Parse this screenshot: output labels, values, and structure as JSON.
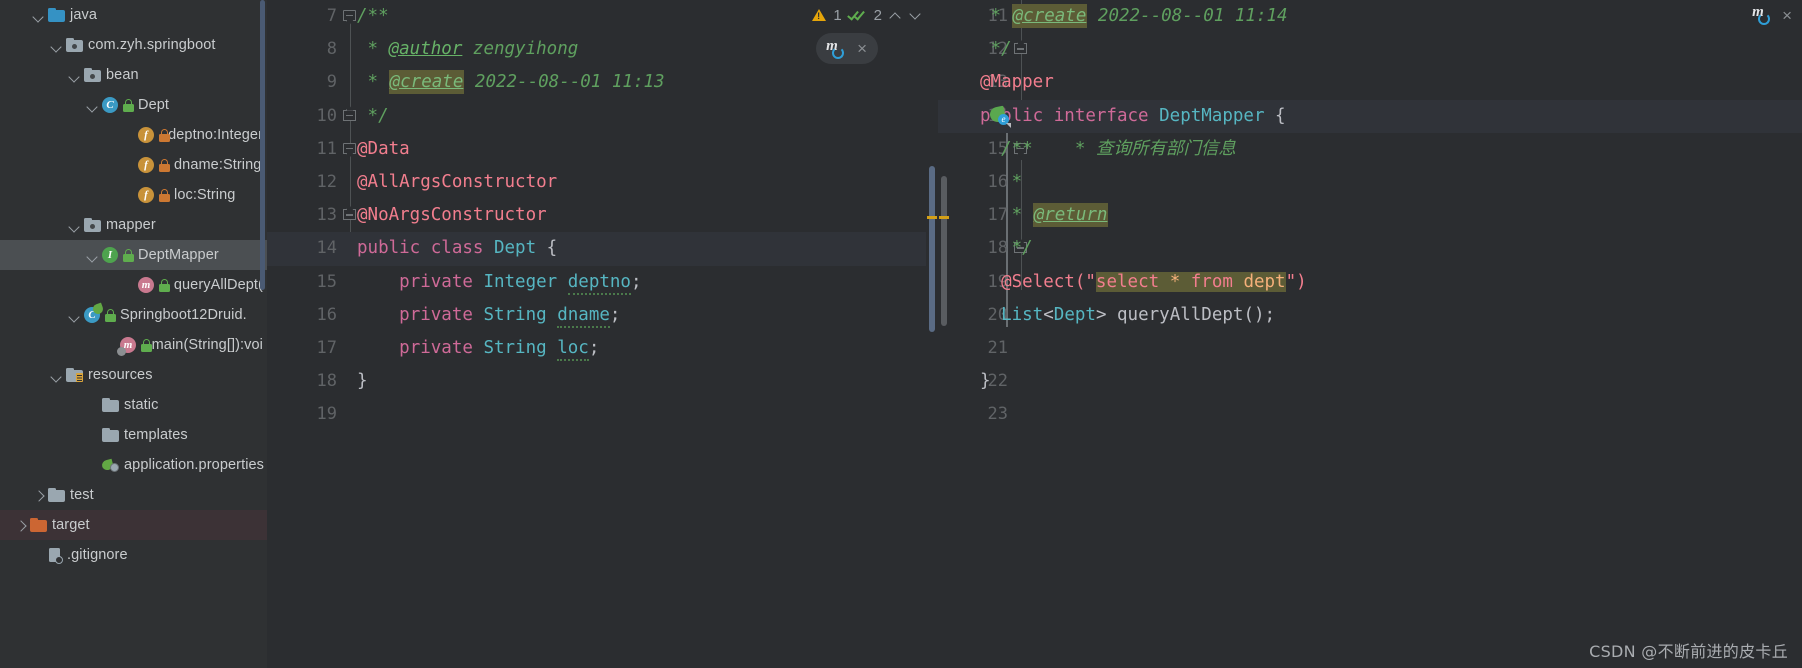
{
  "app": {
    "theme_bg": "#2b2d30",
    "accent": "#3592c4"
  },
  "sidebar": {
    "scroll_visible": true,
    "items": [
      {
        "label": "java",
        "indent": 1,
        "twisty": "down",
        "icon": "folder-blue-icon",
        "lock": "none",
        "selected": false
      },
      {
        "label": "com.zyh.springboot",
        "indent": 2,
        "twisty": "down",
        "icon": "package-icon",
        "lock": "none",
        "selected": false
      },
      {
        "label": "bean",
        "indent": 3,
        "twisty": "down",
        "icon": "package-icon",
        "lock": "none",
        "selected": false
      },
      {
        "label": "Dept",
        "indent": 4,
        "twisty": "down",
        "icon": "class-icon",
        "lock": "green",
        "selected": false
      },
      {
        "label": "deptno:Integer",
        "indent": 6,
        "twisty": "none",
        "icon": "field-icon",
        "lock": "orange",
        "selected": false
      },
      {
        "label": "dname:String",
        "indent": 6,
        "twisty": "none",
        "icon": "field-icon",
        "lock": "orange",
        "selected": false
      },
      {
        "label": "loc:String",
        "indent": 6,
        "twisty": "none",
        "icon": "field-icon",
        "lock": "orange",
        "selected": false
      },
      {
        "label": "mapper",
        "indent": 3,
        "twisty": "down",
        "icon": "package-icon",
        "lock": "none",
        "selected": false
      },
      {
        "label": "DeptMapper",
        "indent": 4,
        "twisty": "down",
        "icon": "interface-icon",
        "lock": "green",
        "selected": true
      },
      {
        "label": "queryAllDept(",
        "indent": 6,
        "twisty": "none",
        "icon": "method-icon",
        "lock": "green",
        "selected": false
      },
      {
        "label": "Springboot12Druid.",
        "indent": 3,
        "twisty": "down",
        "icon": "springboot-class-icon",
        "lock": "green",
        "selected": false
      },
      {
        "label": "main(String[]):voi",
        "indent": 5,
        "twisty": "none",
        "icon": "main-method-icon",
        "lock": "green",
        "selected": false
      },
      {
        "label": "resources",
        "indent": 2,
        "twisty": "down",
        "icon": "resources-folder-icon",
        "lock": "none",
        "selected": false
      },
      {
        "label": "static",
        "indent": 4,
        "twisty": "none",
        "icon": "folder-gray-icon",
        "lock": "none",
        "selected": false
      },
      {
        "label": "templates",
        "indent": 4,
        "twisty": "none",
        "icon": "folder-gray-icon",
        "lock": "none",
        "selected": false
      },
      {
        "label": "application.properties",
        "indent": 4,
        "twisty": "none",
        "icon": "spring-properties-icon",
        "lock": "none",
        "selected": false
      },
      {
        "label": "test",
        "indent": 1,
        "twisty": "right",
        "icon": "folder-gray-icon",
        "lock": "none",
        "selected": false
      },
      {
        "label": "target",
        "indent": 0,
        "twisty": "right",
        "icon": "folder-orange-icon",
        "lock": "none",
        "selected": false,
        "highlight": "target"
      },
      {
        "label": ".gitignore",
        "indent": 1,
        "twisty": "none",
        "icon": "gitignore-icon",
        "lock": "none",
        "selected": false
      }
    ]
  },
  "inspection_widget": {
    "warning_icon": "warning-triangle-icon",
    "warning_count": "1",
    "ok_icon": "double-check-icon",
    "ok_count": "2",
    "prev_icon": "chevron-up-icon",
    "next_icon": "chevron-down-icon"
  },
  "mybatis_badge_left": {
    "icon": "mybatis-sync-icon",
    "close": "×"
  },
  "mybatis_badge_right": {
    "icon": "mybatis-sync-icon",
    "close": "×"
  },
  "editor_left": {
    "file": "Dept.java",
    "first_line_number": 7,
    "current_line": 14,
    "lines": [
      {
        "n": 7,
        "fold": "open",
        "html": "<span class=\"cmt\">/**</span>"
      },
      {
        "n": 8,
        "fold": "none",
        "html": "<span class=\"cmt\"> * </span><span class=\"tag\">@author</span><span class=\"cmt\"> zengyihong</span>"
      },
      {
        "n": 9,
        "fold": "none",
        "html": "<span class=\"cmt\"> * </span><span class=\"tag-hl\">@create</span><span class=\"cmt\"> 2022--08--01 11:13</span>"
      },
      {
        "n": 10,
        "fold": "close",
        "html": "<span class=\"cmt\"> */</span>"
      },
      {
        "n": 11,
        "fold": "open",
        "html": "<span class=\"anno\">@Data</span>"
      },
      {
        "n": 12,
        "fold": "none",
        "html": "<span class=\"anno\">@AllArgsConstructor</span>"
      },
      {
        "n": 13,
        "fold": "close",
        "html": "<span class=\"anno\">@NoArgsConstructor</span>"
      },
      {
        "n": 14,
        "fold": "none",
        "html": "<span class=\"kw\">public class </span><span class=\"typ\">Dept</span><span class=\"pln\"> {</span>"
      },
      {
        "n": 15,
        "fold": "none",
        "html": "<span class=\"pln\">    </span><span class=\"kw\">private </span><span class=\"typ\">Integer </span><span class=\"ident squig\">deptno</span><span class=\"pln\">;</span>"
      },
      {
        "n": 16,
        "fold": "none",
        "html": "<span class=\"pln\">    </span><span class=\"kw\">private </span><span class=\"typ\">String </span><span class=\"ident squig\">dname</span><span class=\"pln\">;</span>"
      },
      {
        "n": 17,
        "fold": "none",
        "html": "<span class=\"pln\">    </span><span class=\"kw\">private </span><span class=\"typ\">String </span><span class=\"ident squig\">loc</span><span class=\"pln\">;</span>"
      },
      {
        "n": 18,
        "fold": "none",
        "html": "<span class=\"pln\">}</span>"
      },
      {
        "n": 19,
        "fold": "none",
        "html": ""
      }
    ],
    "plain_text": [
      "/**",
      " * @author zengyihong",
      " * @create 2022--08--01 11:13",
      " */",
      "@Data",
      "@AllArgsConstructor",
      "@NoArgsConstructor",
      "public class Dept {",
      "    private Integer deptno;",
      "    private String dname;",
      "    private String loc;",
      "}",
      ""
    ]
  },
  "editor_right": {
    "file": "DeptMapper.java",
    "first_line_number": 11,
    "current_line": 14,
    "gutter_icon_line": 14,
    "gutter_icon": "mybatis-mapper-icon",
    "lines": [
      {
        "n": 11,
        "fold": "none",
        "html": "<span class=\"cmt\"> * </span><span class=\"tag-hl\">@create</span><span class=\"cmt\"> 2022--08--01 11:14</span>"
      },
      {
        "n": 12,
        "fold": "close",
        "html": "<span class=\"cmt\"> */</span>"
      },
      {
        "n": 13,
        "fold": "none",
        "html": "<span class=\"anno\">@Mapper</span>"
      },
      {
        "n": 14,
        "fold": "none",
        "html": "<span class=\"kw\">public interface </span><span class=\"typ\">DeptMapper</span><span class=\"pln\"> {</span>"
      },
      {
        "n": 15,
        "fold": "open",
        "html": "<span class=\"cmt\">  /**    * 查询所有部门信息</span>"
      },
      {
        "n": 16,
        "fold": "none",
        "html": "<span class=\"cmt\">   *</span>"
      },
      {
        "n": 17,
        "fold": "none",
        "html": "<span class=\"cmt\">   * </span><span class=\"tag-hl\">@return</span>"
      },
      {
        "n": 18,
        "fold": "close",
        "html": "<span class=\"cmt\">   */</span>"
      },
      {
        "n": 19,
        "fold": "none",
        "html": "<span class=\"pln\">  </span><span class=\"anno\">@Select(</span><span class=\"str\">\"</span><span class=\"strsql-kw\">select </span><span class=\"strsql\">* </span><span class=\"strsql-kw\">from </span><span class=\"strsql\">dept</span><span class=\"str\">\")</span>"
      },
      {
        "n": 20,
        "fold": "none",
        "html": "<span class=\"pln\">  </span><span class=\"typ\">List</span><span class=\"pln\">&lt;</span><span class=\"typ\">Dept</span><span class=\"pln\">&gt; </span><span class=\"pln\">queryAllDept();</span>"
      },
      {
        "n": 21,
        "fold": "none",
        "html": ""
      },
      {
        "n": 22,
        "fold": "none",
        "html": "<span class=\"pln\">}</span>"
      },
      {
        "n": 23,
        "fold": "none",
        "html": ""
      }
    ],
    "plain_text": [
      " * @create 2022--08--01 11:14",
      " */",
      "@Mapper",
      "public interface DeptMapper {",
      "  /**    * 查询所有部门信息",
      "   *",
      "   * @return",
      "   */",
      "  @Select(\"select * from dept\")",
      "  List<Dept> queryAllDept();",
      "",
      "}",
      ""
    ]
  },
  "watermark": {
    "text": "CSDN @不断前进的皮卡丘"
  }
}
